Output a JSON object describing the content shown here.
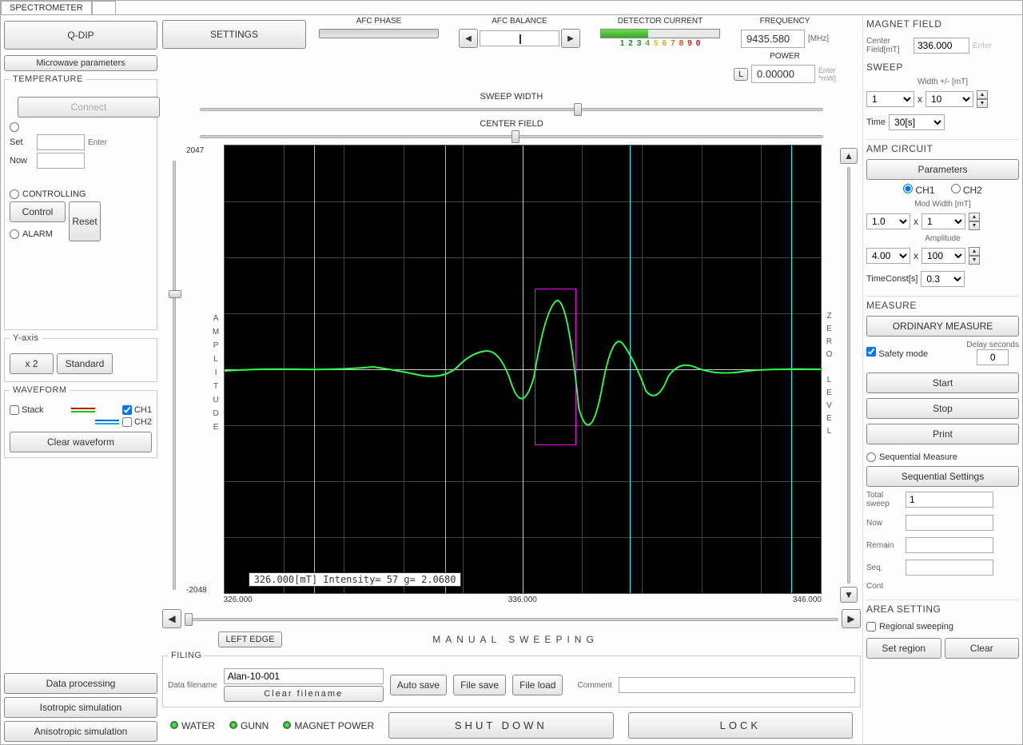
{
  "tab": "SPECTROMETER",
  "top": {
    "qdip": "Q-DIP",
    "settings": "SETTINGS",
    "mw_params": "Microwave parameters",
    "afc_phase": "AFC PHASE",
    "afc_balance": "AFC BALANCE",
    "detector_current": "DETECTOR CURRENT",
    "detector_nums": [
      "1",
      "2",
      "3",
      "4",
      "5",
      "6",
      "7",
      "8",
      "9",
      "0"
    ],
    "frequency_label": "FREQUENCY",
    "frequency_value": "9435.580",
    "frequency_unit": "[MHz]",
    "power_label": "POWER",
    "power_value": "0.00000",
    "power_unit": "*mW]",
    "power_btn": "L",
    "enter": "Enter",
    "sweep_width": "SWEEP WIDTH",
    "center_field": "CENTER FIELD"
  },
  "temp": {
    "title": "TEMPERATURE",
    "connect": "Connect",
    "set": "Set",
    "now": "Now",
    "enter": "Enter",
    "controlling": "CONTROLLING",
    "control": "Control",
    "reset": "Reset",
    "alarm": "ALARM"
  },
  "yaxis": {
    "title": "Y-axis",
    "x2": "x 2",
    "std": "Standard"
  },
  "waveform": {
    "title": "WAVEFORM",
    "stack": "Stack",
    "ch1": "CH1",
    "ch2": "CH2",
    "clear": "Clear waveform"
  },
  "proc": {
    "data_proc": "Data processing",
    "iso": "Isotropic simulation",
    "aniso": "Anisotropic simulation"
  },
  "plot": {
    "amp_label": "AMPLITUDE",
    "zero_label": "ZERO LEVEL",
    "y_top": "2047",
    "y_bot": "-2048",
    "x_left": "326.000",
    "x_mid": "336.000",
    "x_right": "346.000",
    "cursor": "326.000[mT]   Intensity=    57  g= 2.0680",
    "manual": "MANUAL  SWEEPING",
    "left_edge": "LEFT EDGE"
  },
  "filing": {
    "title": "FILING",
    "fname_label": "Data filename",
    "fname": "Alan-10-001",
    "clear": "Clear filename",
    "autosave": "Auto save",
    "filesave": "File save",
    "fileload": "File load",
    "comment_label": "Comment",
    "comment": ""
  },
  "status": {
    "water": "WATER",
    "gunn": "GUNN",
    "magnet": "MAGNET POWER",
    "shutdown": "SHUT DOWN",
    "lock": "LOCK"
  },
  "magnet": {
    "title": "MAGNET FIELD",
    "center_label": "Center Field[mT]",
    "center_value": "336.000",
    "enter": "Enter",
    "sweep_title": "SWEEP",
    "width_label": "Width +/-   [mT]",
    "width_a": "1",
    "width_b": "10",
    "time_label": "Time",
    "time_value": "30[s]"
  },
  "amp": {
    "title": "AMP CIRCUIT",
    "params": "Parameters",
    "ch1": "CH1",
    "ch2": "CH2",
    "modw": "Mod Width [mT]",
    "modw_a": "1.0",
    "modw_b": "1",
    "amplitude": "Amplitude",
    "amp_a": "4.00",
    "amp_b": "100",
    "tc_label": "TimeConst[s]",
    "tc_value": "0.3"
  },
  "measure": {
    "title": "MEASURE",
    "ordinary": "ORDINARY MEASURE",
    "safety": "Safety mode",
    "delay_label": "Delay seconds",
    "delay_value": "0",
    "start": "Start",
    "stop": "Stop",
    "print": "Print",
    "seq_measure": "Sequential Measure",
    "seq_settings": "Sequential Settings",
    "total_sweep": "Total sweep",
    "total_sweep_v": "1",
    "now": "Now",
    "remain": "Remain",
    "seq": "Seq.",
    "cont": "Cont"
  },
  "area": {
    "title": "AREA SETTING",
    "regional": "Regional sweeping",
    "set": "Set region",
    "clear": "Clear"
  }
}
